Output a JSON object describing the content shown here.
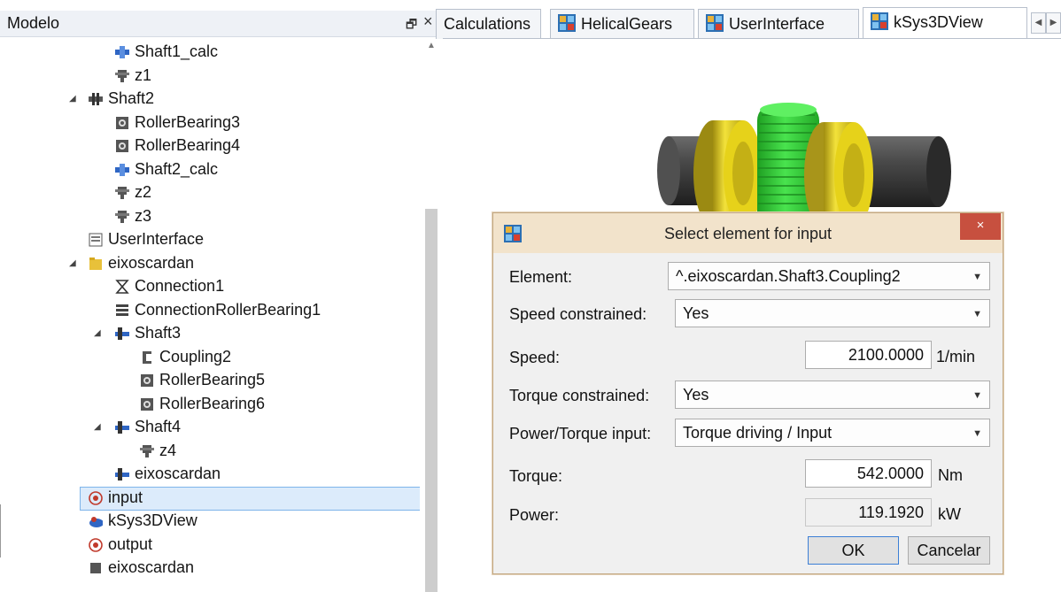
{
  "model_panel": {
    "title": "Modelo",
    "float_glyph": "🗗",
    "close_glyph": "×",
    "tree": [
      {
        "label": "Shaft1_calc",
        "icon": "shaft-calc-icon",
        "level": 4,
        "expander": ""
      },
      {
        "label": "z1",
        "icon": "gear-icon",
        "level": 4,
        "expander": ""
      },
      {
        "label": "Shaft2",
        "icon": "shaft-icon",
        "level": 3,
        "expander": "◢"
      },
      {
        "label": "RollerBearing3",
        "icon": "bearing-icon",
        "level": 4,
        "expander": ""
      },
      {
        "label": "RollerBearing4",
        "icon": "bearing-icon",
        "level": 4,
        "expander": ""
      },
      {
        "label": "Shaft2_calc",
        "icon": "shaft-calc-icon",
        "level": 4,
        "expander": ""
      },
      {
        "label": "z2",
        "icon": "gear-icon",
        "level": 4,
        "expander": ""
      },
      {
        "label": "z3",
        "icon": "gear-icon",
        "level": 4,
        "expander": ""
      },
      {
        "label": "UserInterface",
        "icon": "user-interface-icon",
        "level": 3,
        "expander": ""
      },
      {
        "label": "eixoscardan",
        "icon": "folder-icon",
        "level": 3,
        "expander": "◢"
      },
      {
        "label": "Connection1",
        "icon": "connection-icon",
        "level": 4,
        "expander": ""
      },
      {
        "label": "ConnectionRollerBearing1",
        "icon": "connection-bearing-icon",
        "level": 4,
        "expander": ""
      },
      {
        "label": "Shaft3",
        "icon": "shaft-assembly-icon",
        "level": 4,
        "expander": "◢"
      },
      {
        "label": "Coupling2",
        "icon": "coupling-icon",
        "level": 5,
        "expander": ""
      },
      {
        "label": "RollerBearing5",
        "icon": "bearing-icon",
        "level": 5,
        "expander": ""
      },
      {
        "label": "RollerBearing6",
        "icon": "bearing-icon",
        "level": 5,
        "expander": ""
      },
      {
        "label": "Shaft4",
        "icon": "shaft-assembly-icon",
        "level": 4,
        "expander": "◢"
      },
      {
        "label": "z4",
        "icon": "gear-icon",
        "level": 5,
        "expander": ""
      },
      {
        "label": "eixoscardan",
        "icon": "shaft-assembly-icon",
        "level": 4,
        "expander": ""
      },
      {
        "label": "input",
        "icon": "input-icon",
        "level": 3,
        "expander": "",
        "selected": true
      },
      {
        "label": "kSys3DView",
        "icon": "3d-view-icon",
        "level": 3,
        "expander": ""
      },
      {
        "label": "output",
        "icon": "output-icon",
        "level": 3,
        "expander": ""
      },
      {
        "label": "eixoscardan",
        "icon": "partial-icon",
        "level": 3,
        "expander": "",
        "clipped": true
      }
    ]
  },
  "tabs": [
    {
      "label": "Calculations",
      "icon": ""
    },
    {
      "label": "HelicalGears",
      "icon": "app-icon"
    },
    {
      "label": "UserInterface",
      "icon": "app-icon"
    },
    {
      "label": "kSys3DView",
      "icon": "app-icon",
      "active": true
    }
  ],
  "tab_scroll": {
    "left": "◀",
    "right": "▶"
  },
  "dialog": {
    "title": "Select element for input",
    "close_glyph": "×",
    "fields": {
      "element": {
        "label": "Element:",
        "value": "^.eixoscardan.Shaft3.Coupling2"
      },
      "speed_constrained": {
        "label": "Speed constrained:",
        "value": "Yes"
      },
      "speed": {
        "label": "Speed:",
        "value": "2100.0000",
        "unit": "1/min"
      },
      "torque_constrained": {
        "label": "Torque constrained:",
        "value": "Yes"
      },
      "power_torque_input": {
        "label": "Power/Torque input:",
        "value": "Torque driving / Input"
      },
      "torque": {
        "label": "Torque:",
        "value": "542.0000",
        "unit": "Nm"
      },
      "power": {
        "label": "Power:",
        "value": "119.1920",
        "unit": "kW"
      }
    },
    "ok_label": "OK",
    "cancel_label": "Cancelar"
  },
  "colors": {
    "bearing_yellow": "#e6d21a",
    "gear_green": "#35d83a",
    "shaft_dark": "#3f3f3f",
    "selection_fill": "#dcebfb",
    "dialog_title_bg": "#f2e3cb",
    "close_red": "#c7503f"
  }
}
